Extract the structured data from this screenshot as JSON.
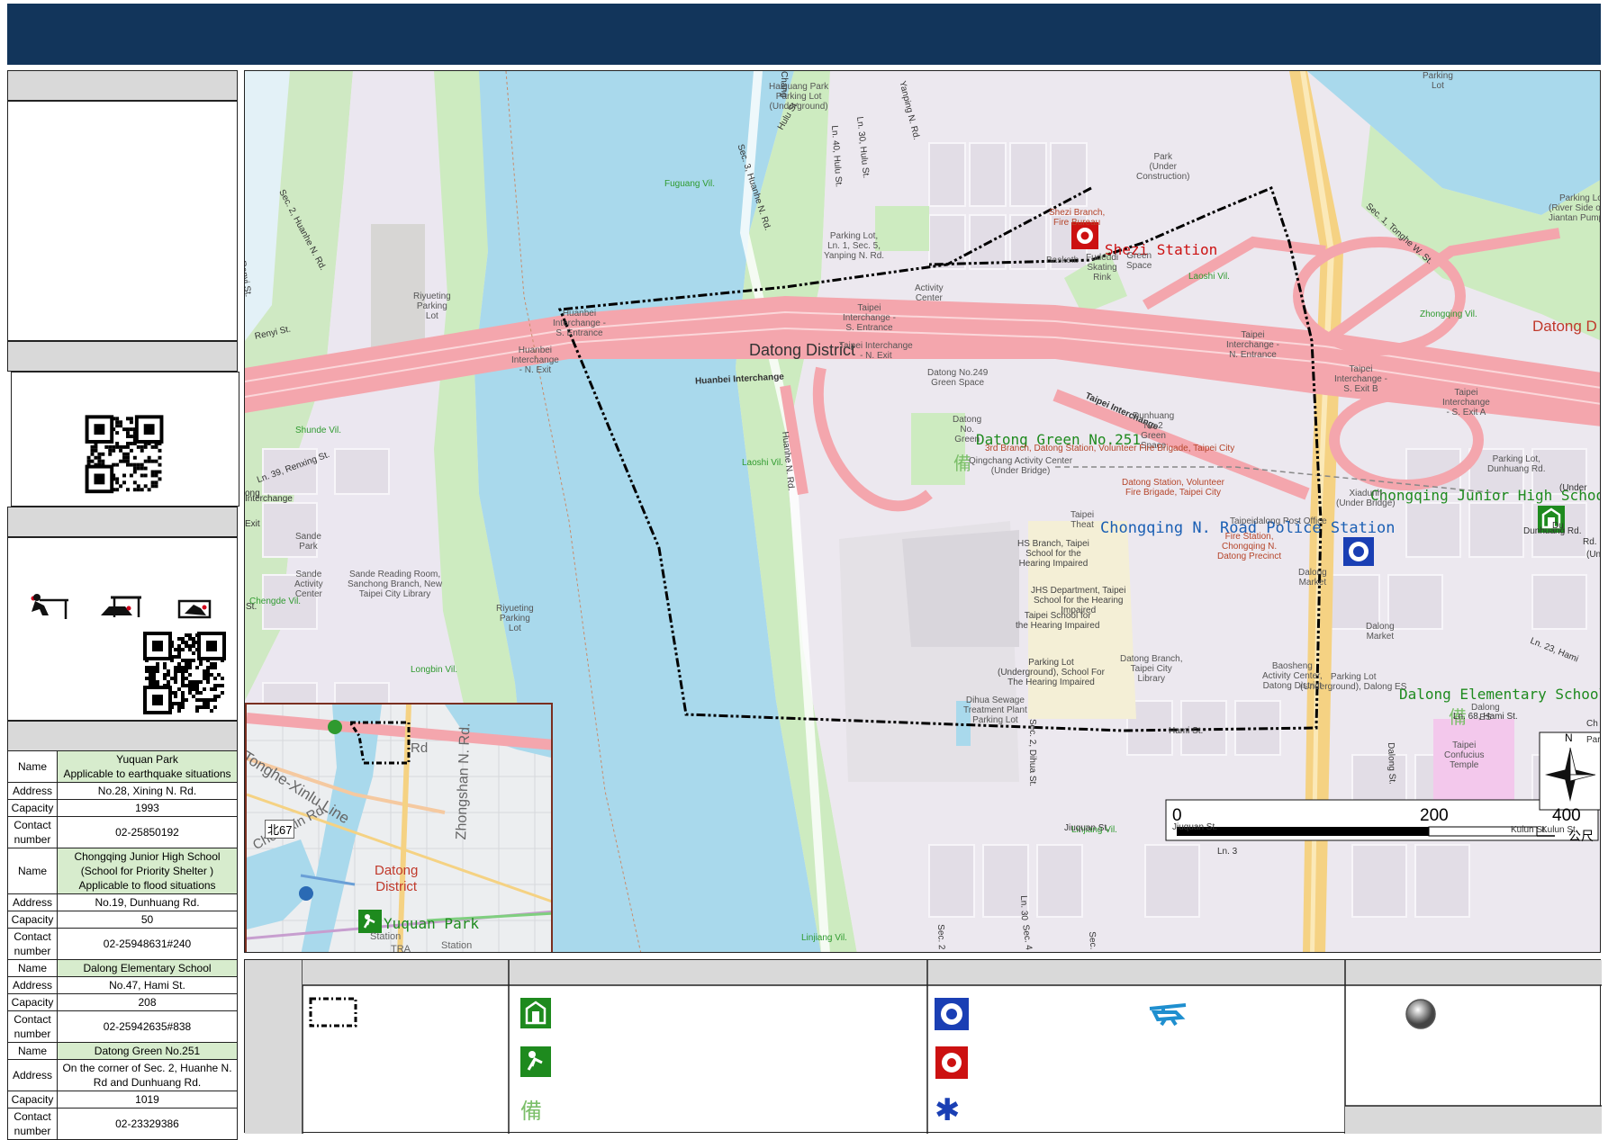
{
  "header": {
    "title": ""
  },
  "map": {
    "district_label": "Datong District",
    "interchange_label": "Huanbei Interchange",
    "taipei_interchange": "Taipei Interchange",
    "facilities": {
      "shezi_station": "Shezi Station",
      "police_station": "Chongqing N. Road Police Station",
      "datong_green": "Datong Green No.251",
      "chongqing_jhs": "Chongqing Junior High School",
      "dalong_es": "Dalong Elementary School",
      "yuquan_park": "Yuquan Park"
    },
    "pois": [
      {
        "id": "haiguang",
        "text": "Haiguang Park\nParking Lot\n(Underground)"
      },
      {
        "id": "parking-yanping",
        "text": "Parking Lot,\nLn. 1, Sec. 5,\nYanping N. Rd."
      },
      {
        "id": "shezi-branch",
        "text": "Shezi Branch,\nFire Bureau"
      },
      {
        "id": "fudeudi",
        "text": "Fudeudi\nSkating\nRink"
      },
      {
        "id": "park-uc",
        "text": "Park\n(Under\nConstruction)"
      },
      {
        "id": "riyueting1",
        "text": "Riyueting\nParking\nLot"
      },
      {
        "id": "riyueting2",
        "text": "Riyueting\nParking\nLot"
      },
      {
        "id": "huanbei-s",
        "text": "Huanbei\nInterchange -\nS. Entrance"
      },
      {
        "id": "huanbei-n",
        "text": "Huanbei\nInterchange\n- N. Exit"
      },
      {
        "id": "taipei-int-s",
        "text": "Taipei\nInterchange -\nS. Entrance"
      },
      {
        "id": "taipei-int-n",
        "text": "Taipei Interchange\n- N. Exit"
      },
      {
        "id": "datong249",
        "text": "Datong No.249\nGreen Space"
      },
      {
        "id": "dunhuang2",
        "text": "Dunhuang\nNo.2\nGreen\nSpace"
      },
      {
        "id": "qingchang",
        "text": "Qingchang Activity Center\n(Under Bridge)"
      },
      {
        "id": "3rd-branch",
        "text": "3rd Branch, Datong Station, Volunteer Fire Brigade, Taipei City"
      },
      {
        "id": "datong-station",
        "text": "Datong Station, Volunteer\nFire Brigade, Taipei City"
      },
      {
        "id": "hs-branch",
        "text": "HS Branch, Taipei\nSchool for the\nHearing Impaired"
      },
      {
        "id": "jhs-dept",
        "text": "JHS Department, Taipei\nSchool for the Hearing\nImpaired"
      },
      {
        "id": "taipei-school",
        "text": "Taipei School for\nthe Hearing Impaired"
      },
      {
        "id": "parking-ug",
        "text": "Parking Lot\n(Underground), School For\nThe Hearing Impaired"
      },
      {
        "id": "dihua",
        "text": "Dihua Sewage\nTreatment Plant\nParking Lot"
      },
      {
        "id": "datong-library",
        "text": "Datong Branch,\nTaipei City\nLibrary"
      },
      {
        "id": "baosheng",
        "text": "Baosheng\nActivity Center,\nDatong District"
      },
      {
        "id": "dalong-market",
        "text": "Dalong\nMarket"
      },
      {
        "id": "dalong-market2",
        "text": "Dalong\nMarket"
      },
      {
        "id": "parking-dalong",
        "text": "Parking Lot\n(Underground), Dalong ES"
      },
      {
        "id": "confucius",
        "text": "Taipei\nConfucius\nTemple"
      },
      {
        "id": "sande-park",
        "text": "Sande\nPark"
      },
      {
        "id": "sande-act",
        "text": "Sande\nActivity\nCenter"
      },
      {
        "id": "sande-reading",
        "text": "Sande Reading Room,\nSanchong Branch, New\nTaipei City Library"
      },
      {
        "id": "parking-dunhuang",
        "text": "Parking Lot,\nDunhuang Rd."
      },
      {
        "id": "parking-river",
        "text": "Parking Lot\n(River Side of Le\nJiantan Pumping"
      },
      {
        "id": "taipei-int-exit-b",
        "text": "Taipei\nInterchange -\nS. Exit B"
      },
      {
        "id": "taipei-int-exit-a",
        "text": "Taipei\nInterchange\n- S. Exit A"
      },
      {
        "id": "taipei-int-ne",
        "text": "Taipei\nInterchange -\nN. Entrance"
      },
      {
        "id": "xiadunh",
        "text": "Xiadunh\n(Under Bridge)"
      },
      {
        "id": "basketball",
        "text": "Basketb"
      },
      {
        "id": "activity-center",
        "text": "Activity\nCenter"
      },
      {
        "id": "post-office",
        "text": "Taipeidalong Post Office"
      },
      {
        "id": "fire-station",
        "text": "Fire Station,\nChongqing N.\nDatong Precinct"
      },
      {
        "id": "dalong-es-small",
        "text": "Dalong\nES"
      },
      {
        "id": "taipei-theat",
        "text": "Taipei\nTheat"
      },
      {
        "id": "datong-no-green",
        "text": "Datong\nNo.\nGreen"
      },
      {
        "id": "parking-lot-top",
        "text": "Parking\nLot"
      },
      {
        "id": "shezi-green",
        "text": "Green\nSpace"
      }
    ],
    "villages": [
      "Fuguang Vil.",
      "Laoshi Vil.",
      "Laoshi Vil.",
      "Zhongqing Vil.",
      "Shunde Vil.",
      "Chengde Vil.",
      "Longbin Vil.",
      "Linjiang Vil.",
      "Linjiang Vil."
    ],
    "roads": [
      "Sec. 2, Huanhe N. Rd.",
      "Sec. 3, Huanhe N. Rd.",
      "Huanhe N. Rd.",
      "Ln. 40, Hulu St.",
      "Ln. 30, Hulu St.",
      "Yanping N. Rd.",
      "Hulu St.",
      "Sec. 1, Tonghe W. St.",
      "Renyi St.",
      "Ln. 39, Renxing St.",
      "Hami St.",
      "Jiuquan St.",
      "Kulun St.",
      "Sec. 2, Dihua St.",
      "Dalong St.",
      "Ln. 68, Hami St.",
      "Ln. 23, Hami",
      "Ln. 3",
      "Dunhuang Rd.",
      "Jiuquan St.",
      "Ln. 30",
      "Sec. 2",
      "Sec. 4",
      "Sec. 2",
      "Renyi St.",
      "St."
    ],
    "partial_labels": [
      "Datong D",
      "(Under",
      "Chang",
      "ong",
      "Interchange",
      "Exit",
      "(Un",
      "Du",
      "Rd.",
      "Par",
      "Ch",
      "Kulun St."
    ],
    "scale": {
      "zero": "0",
      "mid": "200",
      "end": "400",
      "unit": "公尺"
    },
    "north": "N"
  },
  "inset": {
    "labels": {
      "line": "Tonghe-Xinlu Line",
      "road": "Chongxin Rd.",
      "zhongshan": "Zhongshan N. Rd.",
      "district": "Datong\nDistrict",
      "park": "Yuquan Park",
      "route": "北67",
      "station": "Station",
      "tra": "TRA",
      "station2": "Station",
      "rd": "Rd"
    }
  },
  "shelters": [
    {
      "name_lines": [
        "Yuquan Park",
        "Applicable to earthquake situations"
      ],
      "address": "No.28, Xining N. Rd.",
      "capacity": "1993",
      "contact": "02-25850192"
    },
    {
      "name_lines": [
        "Chongqing Junior High School",
        "(School for Priority Shelter )",
        "Applicable to flood situations"
      ],
      "address": "No.19, Dunhuang Rd.",
      "capacity": "50",
      "contact": "02-25948631#240"
    },
    {
      "name_lines": [
        "Dalong Elementary School"
      ],
      "address": "No.47, Hami St.",
      "capacity": "208",
      "contact": "02-25942635#838"
    },
    {
      "name_lines": [
        "Datong Green No.251"
      ],
      "address": "On the corner of Sec. 2, Huanhe N. Rd and Dunhuang Rd.",
      "capacity": "1019",
      "contact": "02-23329386"
    }
  ],
  "table_keys": {
    "name": "Name",
    "address": "Address",
    "capacity": "Capacity",
    "contact": "Contact number"
  },
  "colors": {
    "header": "#12355b",
    "river": "#a9d9ec",
    "highway": "#f4a6ad",
    "park": "#cdebc0",
    "boundary": "#000000",
    "shelter_green": "#1e8a1e",
    "police_blue": "#1a3fb4",
    "fire_red": "#cc1111"
  }
}
